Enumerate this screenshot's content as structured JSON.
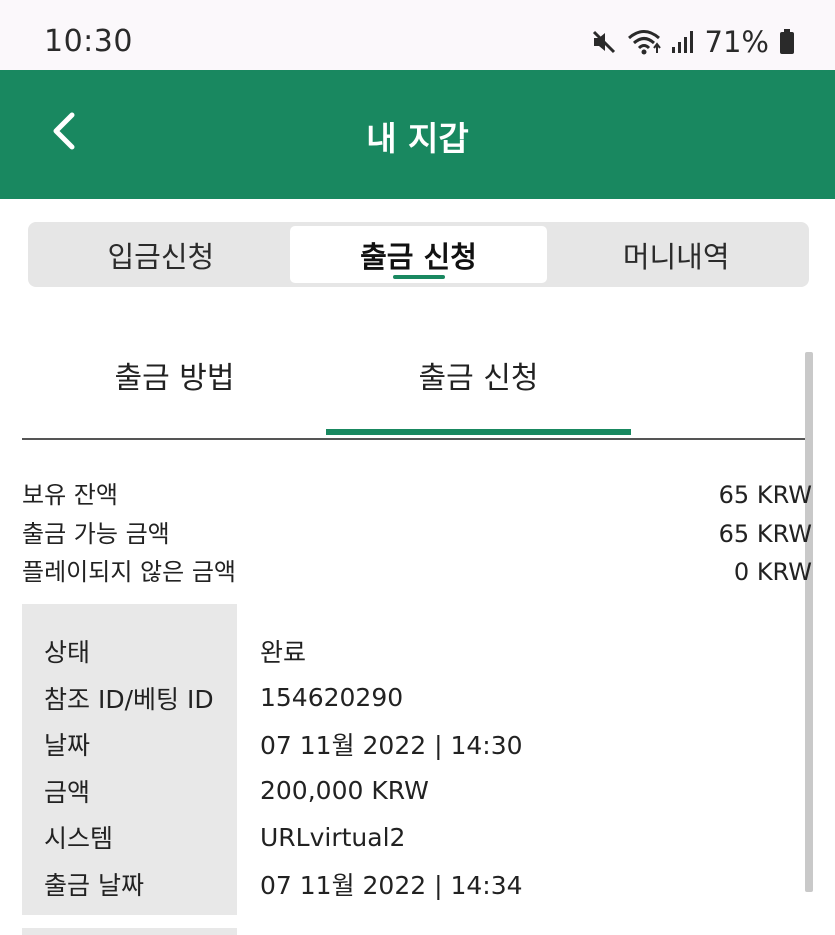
{
  "status_bar": {
    "time": "10:30",
    "battery": "71%"
  },
  "app_bar": {
    "title": "내 지갑"
  },
  "segments": [
    {
      "label": "입금신청",
      "active": false
    },
    {
      "label": "출금 신청",
      "active": true
    },
    {
      "label": "머니내역",
      "active": false
    }
  ],
  "sub_tabs": [
    {
      "label": "출금 방법",
      "active": false
    },
    {
      "label": "출금 신청",
      "active": true
    }
  ],
  "balance": [
    {
      "label": "보유 잔액",
      "value": "65 KRW"
    },
    {
      "label": "출금 가능 금액",
      "value": "65 KRW"
    },
    {
      "label": "플레이되지 않은 금액",
      "value": "0 KRW"
    }
  ],
  "detail": [
    {
      "label": "상태",
      "value": "완료"
    },
    {
      "label": "참조 ID/베팅 ID",
      "value": "154620290"
    },
    {
      "label": "날짜",
      "value": "07 11월 2022 | 14:30"
    },
    {
      "label": "금액",
      "value": "200,000 KRW"
    },
    {
      "label": "시스템",
      "value": "URLvirtual2"
    },
    {
      "label": "출금 날짜",
      "value": "07 11월 2022 | 14:34"
    }
  ],
  "colors": {
    "brand": "#198860",
    "panel": "#e8e8e8"
  }
}
